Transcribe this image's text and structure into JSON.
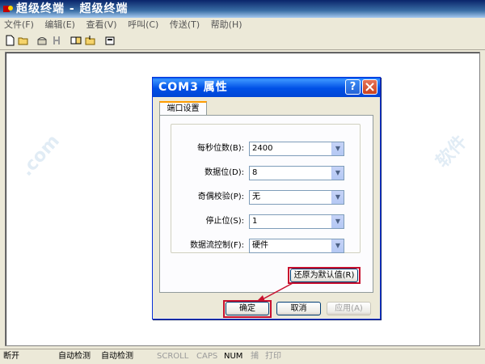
{
  "window": {
    "title": "超级终端 - 超级终端"
  },
  "menu": [
    "文件(F)",
    "编辑(E)",
    "查看(V)",
    "呼叫(C)",
    "传送(T)",
    "帮助(H)"
  ],
  "dialog": {
    "title": "COM3 属性",
    "tab": "端口设置",
    "fields": [
      {
        "label": "每秒位数(B):",
        "value": "2400"
      },
      {
        "label": "数据位(D):",
        "value": "8"
      },
      {
        "label": "奇偶校验(P):",
        "value": "无"
      },
      {
        "label": "停止位(S):",
        "value": "1"
      },
      {
        "label": "数据流控制(F):",
        "value": "硬件"
      }
    ],
    "restore_label": "还原为默认值(R)",
    "ok_label": "确定",
    "cancel_label": "取消",
    "apply_label": "应用(A)"
  },
  "status": {
    "connection": "断开",
    "detect1": "自动检测",
    "detect2": "自动检测",
    "scroll": "SCROLL",
    "caps": "CAPS",
    "num": "NUM",
    "capture": "捕",
    "print": "打印"
  },
  "colors": {
    "highlight": "#C8102E",
    "dialog_title": "#0050E6"
  }
}
